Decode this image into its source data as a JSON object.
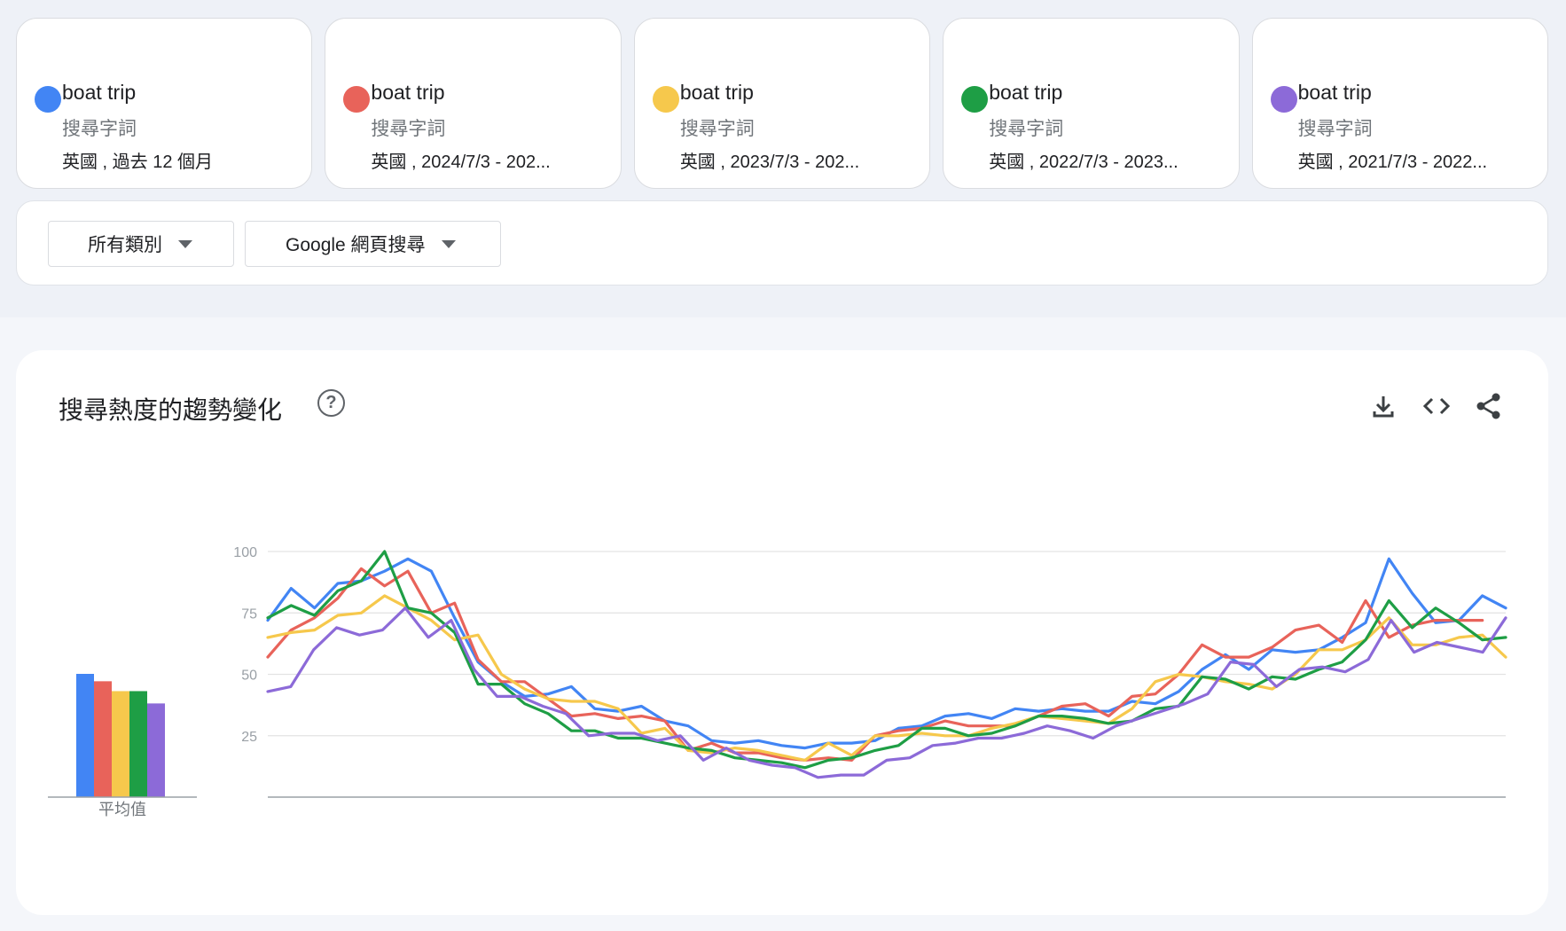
{
  "cards": [
    {
      "term": "boat trip",
      "kind": "搜尋字詞",
      "range": "英國 , 過去 12 個月",
      "color": "#4285f4"
    },
    {
      "term": "boat trip",
      "kind": "搜尋字詞",
      "range": "英國 , 2024/7/3 - 202...",
      "color": "#e8635a"
    },
    {
      "term": "boat trip",
      "kind": "搜尋字詞",
      "range": "英國 , 2023/7/3 - 202...",
      "color": "#f6c84c"
    },
    {
      "term": "boat trip",
      "kind": "搜尋字詞",
      "range": "英國 , 2022/7/3 - 2023...",
      "color": "#1e9e45"
    },
    {
      "term": "boat trip",
      "kind": "搜尋字詞",
      "range": "英國 , 2021/7/3 - 2022...",
      "color": "#8c6ad8"
    }
  ],
  "filters": {
    "category_label": "所有類別",
    "search_type_label": "Google 網頁搜尋"
  },
  "panel": {
    "title": "搜尋熱度的趨勢變化",
    "help_icon": "help-circle-icon",
    "tools": [
      "download-icon",
      "embed-code-icon",
      "share-icon"
    ]
  },
  "chart_data": {
    "type": "line",
    "ylim": [
      0,
      100
    ],
    "yticks": [
      25,
      50,
      75,
      100
    ],
    "grid": true,
    "average_label": "平均值",
    "averages": [
      50,
      47,
      43,
      43,
      38
    ],
    "series": [
      {
        "name": "boat trip 英國 , 過去 12 個月",
        "color": "#4285f4",
        "values": [
          72,
          85,
          77,
          87,
          88,
          92,
          97,
          92,
          73,
          55,
          47,
          41,
          42,
          45,
          36,
          35,
          37,
          31,
          29,
          23,
          22,
          23,
          21,
          20,
          22,
          22,
          23,
          28,
          29,
          33,
          34,
          32,
          36,
          35,
          36,
          35,
          35,
          39,
          38,
          43,
          52,
          58,
          52,
          60,
          59,
          60,
          65,
          71,
          97,
          83,
          71,
          72,
          82,
          77
        ]
      },
      {
        "name": "boat trip 英國 , 2024/7/3 - 202...",
        "color": "#e8635a",
        "values": [
          57,
          68,
          73,
          81,
          93,
          86,
          92,
          75,
          79,
          56,
          47,
          47,
          40,
          33,
          34,
          32,
          33,
          31,
          19,
          22,
          18,
          18,
          16,
          15,
          16,
          15,
          25,
          27,
          28,
          31,
          29,
          29,
          29,
          33,
          37,
          38,
          33,
          41,
          42,
          50,
          62,
          57,
          57,
          61,
          68,
          70,
          63,
          80,
          65,
          70,
          72,
          72,
          72,
          null
        ]
      },
      {
        "name": "boat trip 英國 , 2023/7/3 - 202...",
        "color": "#f6c84c",
        "values": [
          65,
          67,
          68,
          74,
          75,
          82,
          77,
          72,
          64,
          66,
          50,
          44,
          40,
          39,
          39,
          36,
          26,
          28,
          19,
          18,
          20,
          19,
          17,
          15,
          22,
          17,
          25,
          25,
          26,
          25,
          25,
          28,
          30,
          33,
          32,
          31,
          30,
          36,
          47,
          50,
          49,
          47,
          46,
          44,
          50,
          60,
          60,
          64,
          73,
          62,
          62,
          65,
          66,
          57
        ]
      },
      {
        "name": "boat trip 英國 , 2022/7/3 - 2023...",
        "color": "#1e9e45",
        "values": [
          73,
          78,
          74,
          84,
          88,
          100,
          77,
          75,
          67,
          46,
          46,
          38,
          34,
          27,
          27,
          24,
          24,
          22,
          20,
          19,
          16,
          15,
          14,
          12,
          15,
          16,
          19,
          21,
          28,
          28,
          25,
          26,
          29,
          33,
          33,
          32,
          30,
          31,
          36,
          37,
          49,
          48,
          44,
          49,
          48,
          52,
          55,
          64,
          80,
          69,
          77,
          71,
          64,
          65
        ]
      },
      {
        "name": "boat trip 英國 , 2021/7/3 - 2022...",
        "color": "#8c6ad8",
        "values": [
          43,
          45,
          60,
          69,
          66,
          68,
          77,
          65,
          72,
          52,
          41,
          41,
          37,
          34,
          25,
          26,
          26,
          23,
          25,
          15,
          20,
          15,
          13,
          12,
          8,
          9,
          9,
          15,
          16,
          21,
          22,
          24,
          24,
          26,
          29,
          27,
          24,
          29,
          32,
          35,
          38,
          42,
          55,
          54,
          45,
          52,
          53,
          51,
          56,
          72,
          59,
          63,
          61,
          59,
          73
        ]
      }
    ]
  }
}
